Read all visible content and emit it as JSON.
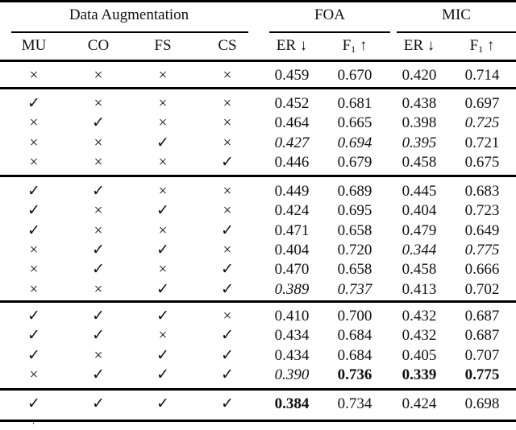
{
  "header": {
    "group_data_augmentation": "Data Augmentation",
    "group_foa": "FOA",
    "group_mic": "MIC",
    "columns": [
      "MU",
      "CO",
      "FS",
      "CS"
    ],
    "metric_er": "ER",
    "metric_f": "F",
    "metric_f_sub": "1",
    "arrow_down": "↓",
    "arrow_up": "↑"
  },
  "symbols": {
    "check": "✓",
    "cross": "×"
  },
  "groups": [
    {
      "rows": [
        {
          "aug": [
            "x",
            "x",
            "x",
            "x"
          ],
          "vals": [
            "0.459",
            "0.670",
            "0.420",
            "0.714"
          ],
          "style": [
            "",
            "",
            "",
            ""
          ]
        }
      ]
    },
    {
      "rows": [
        {
          "aug": [
            "v",
            "x",
            "x",
            "x"
          ],
          "vals": [
            "0.452",
            "0.681",
            "0.438",
            "0.697"
          ],
          "style": [
            "",
            "",
            "",
            ""
          ]
        },
        {
          "aug": [
            "x",
            "v",
            "x",
            "x"
          ],
          "vals": [
            "0.464",
            "0.665",
            "0.398",
            "0.725"
          ],
          "style": [
            "",
            "",
            "",
            "it"
          ]
        },
        {
          "aug": [
            "x",
            "x",
            "v",
            "x"
          ],
          "vals": [
            "0.427",
            "0.694",
            "0.395",
            "0.721"
          ],
          "style": [
            "it",
            "it",
            "it",
            ""
          ]
        },
        {
          "aug": [
            "x",
            "x",
            "x",
            "v"
          ],
          "vals": [
            "0.446",
            "0.679",
            "0.458",
            "0.675"
          ],
          "style": [
            "",
            "",
            "",
            ""
          ]
        }
      ]
    },
    {
      "rows": [
        {
          "aug": [
            "v",
            "v",
            "x",
            "x"
          ],
          "vals": [
            "0.449",
            "0.689",
            "0.445",
            "0.683"
          ],
          "style": [
            "",
            "",
            "",
            ""
          ]
        },
        {
          "aug": [
            "v",
            "x",
            "v",
            "x"
          ],
          "vals": [
            "0.424",
            "0.695",
            "0.404",
            "0.723"
          ],
          "style": [
            "",
            "",
            "",
            ""
          ]
        },
        {
          "aug": [
            "v",
            "x",
            "x",
            "v"
          ],
          "vals": [
            "0.471",
            "0.658",
            "0.479",
            "0.649"
          ],
          "style": [
            "",
            "",
            "",
            ""
          ]
        },
        {
          "aug": [
            "x",
            "v",
            "v",
            "x"
          ],
          "vals": [
            "0.404",
            "0.720",
            "0.344",
            "0.775"
          ],
          "style": [
            "",
            "",
            "it",
            "it"
          ]
        },
        {
          "aug": [
            "x",
            "v",
            "x",
            "v"
          ],
          "vals": [
            "0.470",
            "0.658",
            "0.458",
            "0.666"
          ],
          "style": [
            "",
            "",
            "",
            ""
          ]
        },
        {
          "aug": [
            "x",
            "x",
            "v",
            "v"
          ],
          "vals": [
            "0.389",
            "0.737",
            "0.413",
            "0.702"
          ],
          "style": [
            "it",
            "it",
            "",
            ""
          ]
        }
      ]
    },
    {
      "rows": [
        {
          "aug": [
            "v",
            "v",
            "v",
            "x"
          ],
          "vals": [
            "0.410",
            "0.700",
            "0.432",
            "0.687"
          ],
          "style": [
            "",
            "",
            "",
            ""
          ]
        },
        {
          "aug": [
            "v",
            "v",
            "x",
            "v"
          ],
          "vals": [
            "0.434",
            "0.684",
            "0.432",
            "0.687"
          ],
          "style": [
            "",
            "",
            "",
            ""
          ]
        },
        {
          "aug": [
            "v",
            "x",
            "v",
            "v"
          ],
          "vals": [
            "0.434",
            "0.684",
            "0.405",
            "0.707"
          ],
          "style": [
            "",
            "",
            "",
            ""
          ]
        },
        {
          "aug": [
            "x",
            "v",
            "v",
            "v"
          ],
          "vals": [
            "0.390",
            "0.736",
            "0.339",
            "0.775"
          ],
          "style": [
            "it",
            "bd",
            "bd",
            "bd"
          ]
        }
      ]
    },
    {
      "rows": [
        {
          "aug": [
            "v",
            "v",
            "v",
            "v"
          ],
          "vals": [
            "0.384",
            "0.734",
            "0.424",
            "0.698"
          ],
          "style": [
            "bd",
            "",
            "",
            ""
          ]
        }
      ]
    }
  ],
  "footnote_mark": "‘"
}
